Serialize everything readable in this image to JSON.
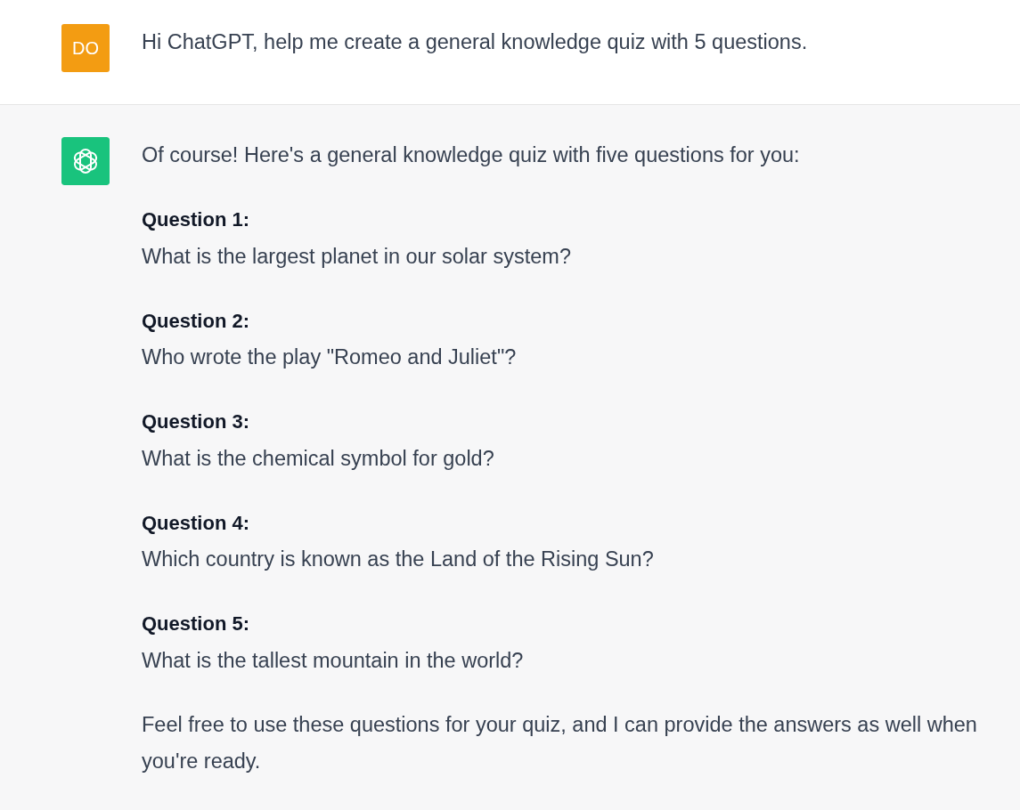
{
  "messages": [
    {
      "kind": "user",
      "avatar": "DO",
      "blocks": [
        {
          "kind": "text",
          "text": "Hi ChatGPT, help me create a general knowledge quiz with 5 questions."
        }
      ]
    },
    {
      "kind": "assistant",
      "blocks": [
        {
          "kind": "text",
          "text": "Of course! Here's a general knowledge quiz with five questions for you:"
        },
        {
          "kind": "question",
          "label": "Question 1:",
          "text": "What is the largest planet in our solar system?"
        },
        {
          "kind": "question",
          "label": "Question 2:",
          "text": "Who wrote the play \"Romeo and Juliet\"?"
        },
        {
          "kind": "question",
          "label": "Question 3:",
          "text": "What is the chemical symbol for gold?"
        },
        {
          "kind": "question",
          "label": "Question 4:",
          "text": "Which country is known as the Land of the Rising Sun?"
        },
        {
          "kind": "question",
          "label": "Question 5:",
          "text": "What is the tallest mountain in the world?"
        },
        {
          "kind": "text",
          "text": "Feel free to use these questions for your quiz, and I can provide the answers as well when you're ready."
        }
      ]
    }
  ]
}
